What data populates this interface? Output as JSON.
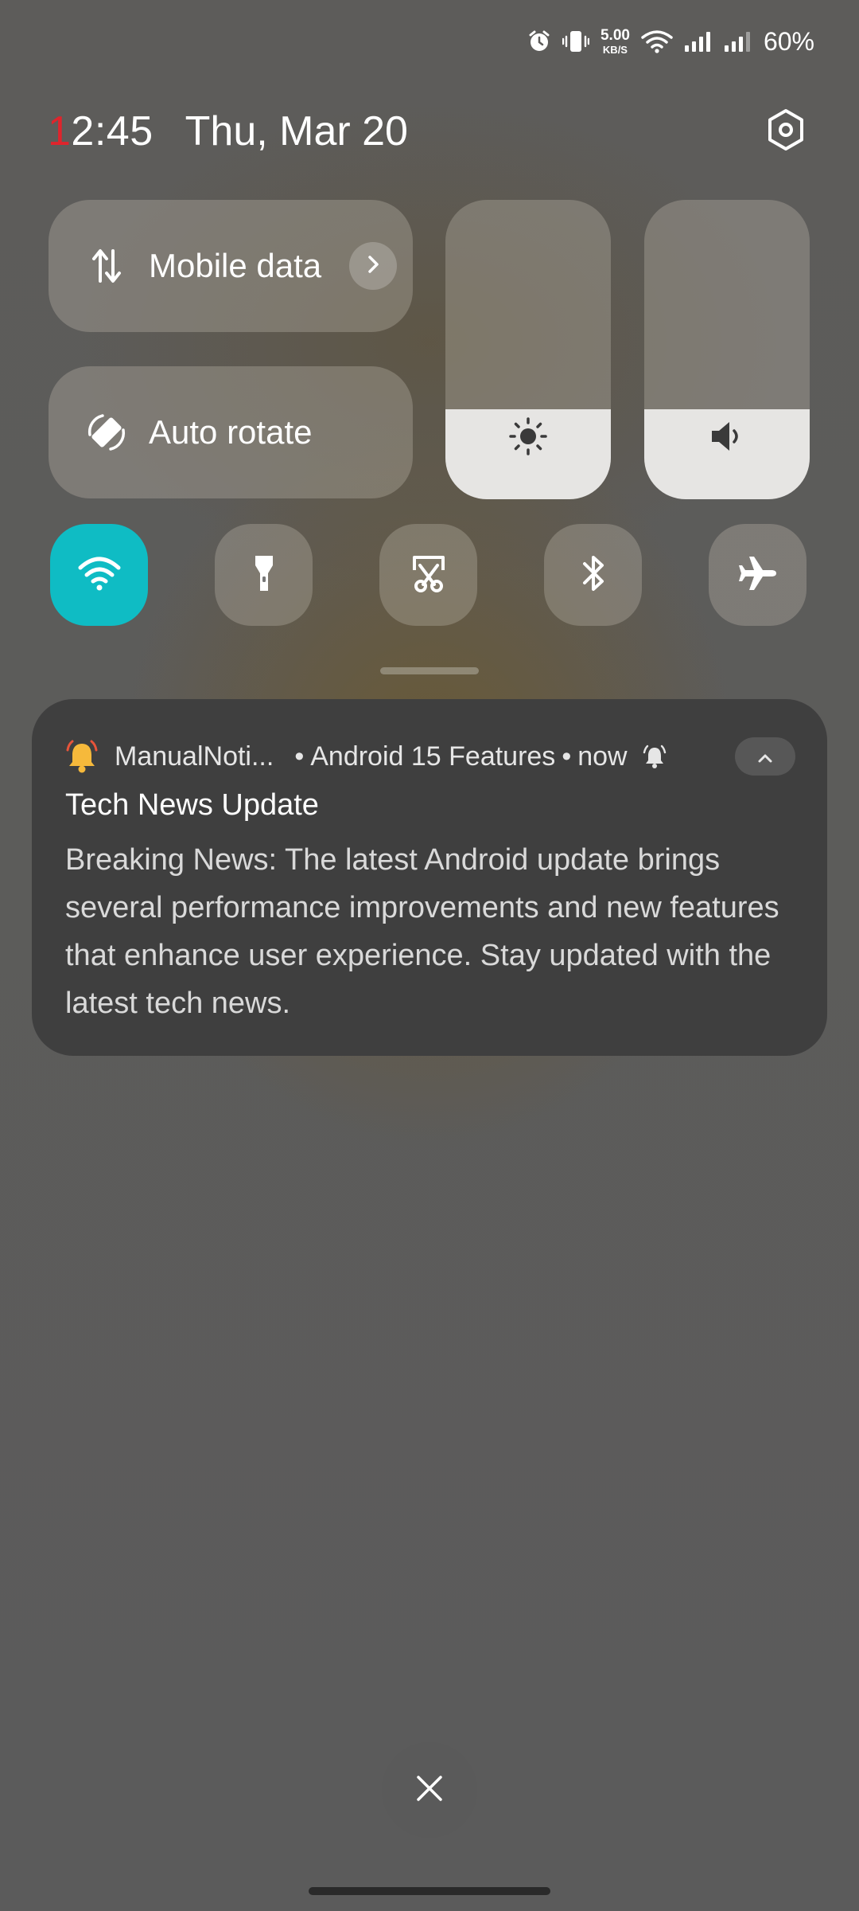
{
  "status_bar": {
    "net_speed_value": "5.00",
    "net_speed_unit": "KB/S",
    "battery_percent": "60%",
    "icons": [
      "alarm-icon",
      "vibrate-icon",
      "wifi-icon",
      "signal-icon",
      "signal-icon"
    ]
  },
  "header": {
    "clock_first_digit": "1",
    "clock_rest": "2:45",
    "date": "Thu, Mar 20",
    "settings_icon": "settings-hexagon-icon"
  },
  "tiles": {
    "mobile_data_label": "Mobile data",
    "auto_rotate_label": "Auto rotate"
  },
  "sliders": {
    "brightness_level": 0.3,
    "volume_level": 0.3
  },
  "round_tiles": [
    {
      "name": "wifi",
      "icon": "wifi-icon",
      "active": true
    },
    {
      "name": "flashlight",
      "icon": "flashlight-icon",
      "active": false
    },
    {
      "name": "screenshot",
      "icon": "screenshot-scissors-icon",
      "active": false
    },
    {
      "name": "bluetooth",
      "icon": "bluetooth-icon",
      "active": false
    },
    {
      "name": "airplane-mode",
      "icon": "airplane-icon",
      "active": false
    }
  ],
  "notification": {
    "app_name": "ManualNoti...",
    "channel": "Android 15 Features",
    "time": "now",
    "separator": "•",
    "title": "Tech News Update",
    "body": "Breaking News: The latest Android update brings several performance improvements and new features that enhance user experience. Stay updated with the latest tech news."
  },
  "colors": {
    "active_tile": "#0fbcc4",
    "clock_accent": "#e0242c",
    "notification_bg": "#3f3f3f"
  }
}
